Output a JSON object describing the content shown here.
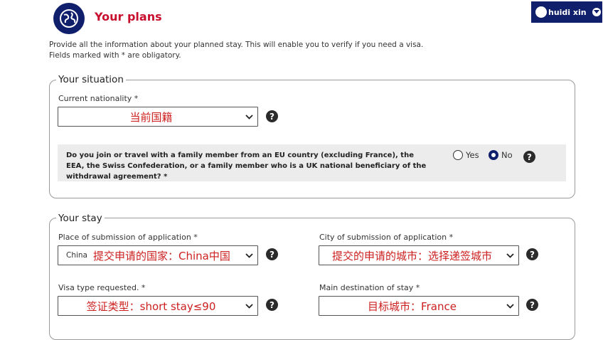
{
  "header": {
    "title": "Your plans",
    "logo_icon": "globe-icon",
    "user_name": "huidi xin"
  },
  "intro": {
    "line1": "Provide all the information about your planned stay. This will enable you to verify if you need a visa.",
    "line2": "Fields marked with * are obligatory."
  },
  "situation": {
    "legend": "Your situation",
    "nationality_label": "Current nationality *",
    "nationality_value": "当前国籍",
    "family_question": "Do you join or travel with a family member from an EU country (excluding France), the EEA, the Swiss Confederation, or a family member who is a UK national beneficiary of the withdrawal agreement? *",
    "yes_label": "Yes",
    "no_label": "No",
    "selected": "No"
  },
  "stay": {
    "legend": "Your stay",
    "place_label": "Place of submission of application *",
    "place_prefix": "China",
    "place_value": "提交申请的国家：China中国",
    "city_label": "City of submission of application *",
    "city_value": "提交的申请的城市：选择递签城市",
    "visa_label": "Visa type requested. *",
    "visa_value": "签证类型：short stay≤90",
    "dest_label": "Main destination of stay *",
    "dest_value": "目标城市：France"
  },
  "colors": {
    "brand_navy": "#0f1f6b",
    "title_red": "#c8102e",
    "annotation_red": "#cc1f1f"
  }
}
